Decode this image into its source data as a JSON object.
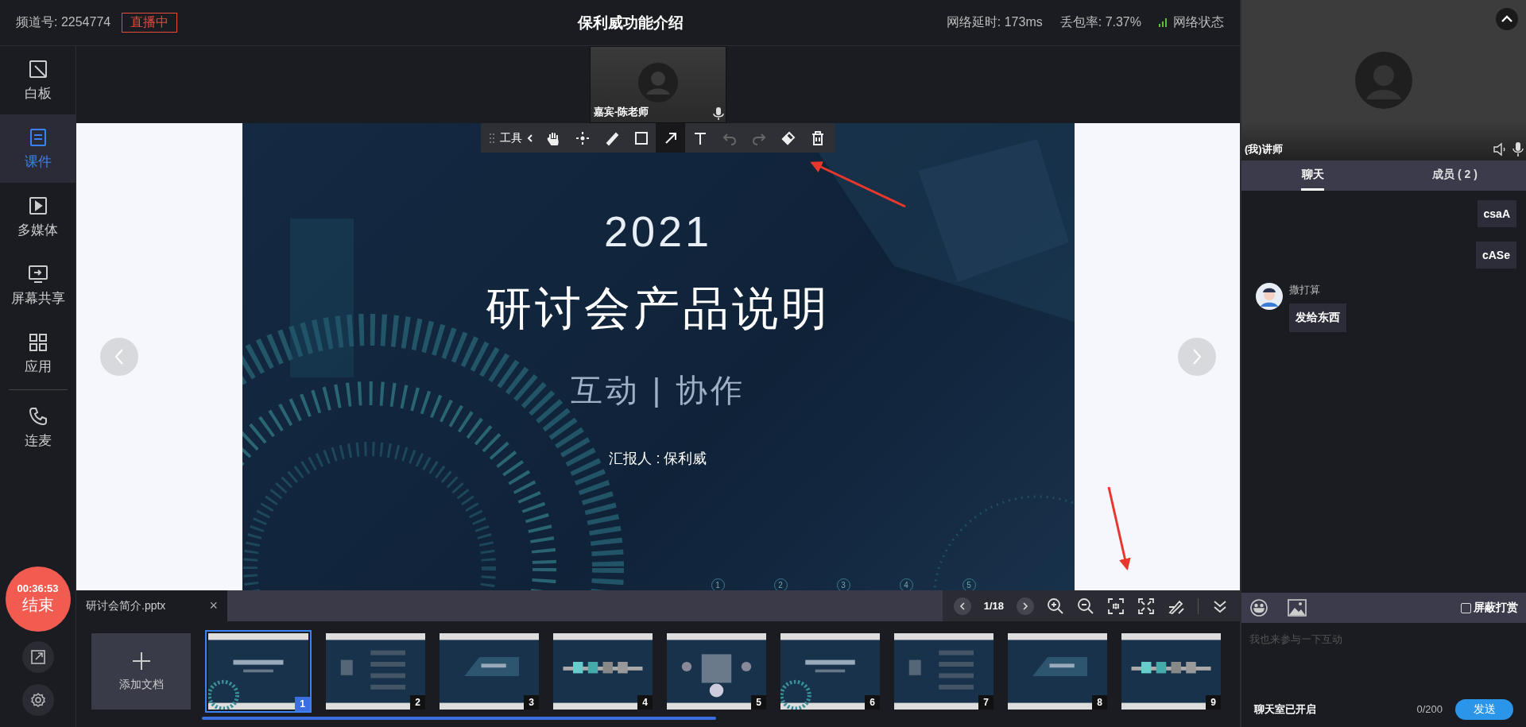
{
  "header": {
    "channel": "频道号: 2254774",
    "live_badge": "直播中",
    "title": "保利威功能介绍",
    "latency": "网络延时: 173ms",
    "packet_loss": "丢包率: 7.37%",
    "network_status": "网络状态"
  },
  "sidebar": {
    "items": [
      {
        "kind": "whiteboard",
        "label": "白板",
        "selected": false
      },
      {
        "kind": "courseware",
        "label": "课件",
        "selected": true
      },
      {
        "kind": "media",
        "label": "多媒体",
        "selected": false
      },
      {
        "kind": "screen",
        "label": "屏幕共享",
        "selected": false
      },
      {
        "kind": "apps",
        "label": "应用",
        "selected": false
      },
      {
        "kind": "phone",
        "label": "连麦",
        "selected": false
      }
    ],
    "timer": "00:36:53",
    "end_label": "结束"
  },
  "guest_video": {
    "name": "嘉宾-陈老师"
  },
  "toolbar": {
    "label": "工具",
    "tools": [
      {
        "kind": "hand",
        "selected": false,
        "disabled": false
      },
      {
        "kind": "move",
        "selected": false,
        "disabled": false
      },
      {
        "kind": "pencil",
        "selected": false,
        "disabled": false
      },
      {
        "kind": "rect",
        "selected": false,
        "disabled": false
      },
      {
        "kind": "arrow",
        "selected": true,
        "disabled": false
      },
      {
        "kind": "text",
        "selected": false,
        "disabled": false
      },
      {
        "kind": "undo",
        "selected": false,
        "disabled": true
      },
      {
        "kind": "redo",
        "selected": false,
        "disabled": true
      },
      {
        "kind": "eraser",
        "selected": false,
        "disabled": false
      },
      {
        "kind": "trash",
        "selected": false,
        "disabled": false
      }
    ]
  },
  "slide": {
    "year": "2021",
    "title": "研讨会产品说明",
    "subtitle": "互动 | 协作",
    "presenter": "汇报人 : 保利威",
    "page_dots": [
      "1",
      "2",
      "3",
      "4",
      "5"
    ]
  },
  "document": {
    "tab": "研讨会简介.pptx",
    "close": "×",
    "page": "1/18",
    "add_label": "添加文档",
    "thumbnails": [
      {
        "number": "1",
        "selected": true
      },
      {
        "number": "2",
        "selected": false
      },
      {
        "number": "3",
        "selected": false
      },
      {
        "number": "4",
        "selected": false
      },
      {
        "number": "5",
        "selected": false
      },
      {
        "number": "6",
        "selected": false
      },
      {
        "number": "7",
        "selected": false
      },
      {
        "number": "8",
        "selected": false
      },
      {
        "number": "9",
        "selected": false
      }
    ]
  },
  "chat": {
    "video_name": "(我)讲师",
    "tabs": [
      {
        "label": "聊天",
        "selected": true
      },
      {
        "label": "成员 ( 2 )",
        "selected": false
      }
    ],
    "messages": [
      {
        "kind": "self",
        "text": "csaA"
      },
      {
        "kind": "self",
        "text": "cASe"
      },
      {
        "kind": "other",
        "sender": "撒打算",
        "text": "发给东西"
      }
    ],
    "block_gifts": {
      "label": "屏蔽打赏",
      "checked": false
    },
    "placeholder": "我也来参与一下互动",
    "status": "聊天室已开启",
    "count": "0/200",
    "send": "发送"
  }
}
